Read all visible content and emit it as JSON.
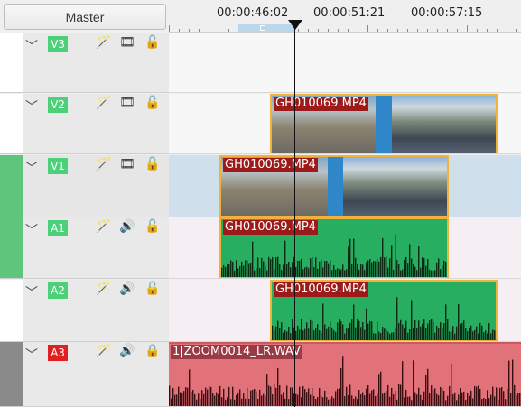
{
  "header": {
    "master_label": "Master"
  },
  "ruler": {
    "timecodes": [
      "00:00:46:02",
      "00:00:51:21",
      "00:00:57:15"
    ]
  },
  "colors": {
    "video_tag": "#4cd07a",
    "audio_tag": "#4cd07a",
    "a3_tag": "#e02020",
    "active_strip": "#5fc47c",
    "a3_strip": "#8a8a8a",
    "clip_border": "#f0b23a",
    "audio_clip_bg": "#27ae60",
    "a3_clip_bg": "#e2727a"
  },
  "tracks": [
    {
      "tag": "V3",
      "icons": [
        "chevron-down-icon",
        "effect-wand-icon",
        "film-icon",
        "lock-open-icon"
      ]
    },
    {
      "tag": "V2",
      "icons": [
        "chevron-down-icon",
        "effect-wand-icon",
        "film-icon",
        "lock-open-icon"
      ]
    },
    {
      "tag": "V1",
      "icons": [
        "chevron-down-icon",
        "effect-wand-icon",
        "film-icon",
        "lock-open-icon"
      ]
    },
    {
      "tag": "A1",
      "icons": [
        "chevron-down-icon",
        "effect-wand-icon",
        "speaker-icon",
        "lock-open-icon"
      ]
    },
    {
      "tag": "A2",
      "icons": [
        "chevron-down-icon",
        "effect-wand-icon",
        "speaker-icon",
        "lock-open-icon"
      ]
    },
    {
      "tag": "A3",
      "icons": [
        "chevron-down-icon",
        "effect-wand-icon",
        "speaker-icon",
        "lock-closed-icon"
      ]
    }
  ],
  "clips": {
    "v2": "GH010069.MP4",
    "v1": "GH010069.MP4",
    "a1": "GH010069.MP4",
    "a2": "GH010069.MP4",
    "a3": "1|ZOOM0014_LR.WAV"
  }
}
